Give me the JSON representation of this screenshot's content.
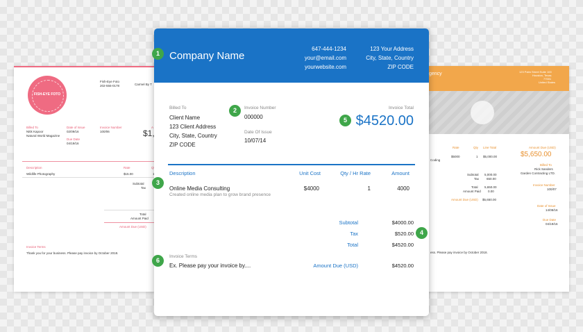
{
  "left_invoice": {
    "accent": "#ef6b82",
    "badge_text": "FISH-EYE FOTO",
    "from": [
      "Fish-Eye Foto",
      "202-555-0178"
    ],
    "from_right": "Carmel By T",
    "billed_to_label": "Billed To",
    "billed_to": [
      "Nitik Kapoor",
      "Natural World Magazine"
    ],
    "date_label": "Date of Issue",
    "date": "02/09/16",
    "invoice_no_label": "Invoice Number",
    "invoice_no": "100/06",
    "due_label": "Due Date",
    "due": "04/19/16",
    "amount_partial": "$1,",
    "a_partial": "A",
    "desc_header": "Description",
    "rate_header": "Rate",
    "qty_partial": "Qt",
    "item": "Wildlife Photography",
    "item_rate": "$15.00",
    "item_qty": "1",
    "subtotal_label": "Subtotal",
    "tax_label": "Tax",
    "total_label": "Total",
    "paid_label": "Amount Paid",
    "due_amount_label": "Amount Due (USD)",
    "terms_label": "Invoice Terms",
    "terms_text": "Thank you for your business. Please pay invoice by October 2018."
  },
  "right_invoice": {
    "accent": "#f2a74b",
    "header_title_partial": "gency",
    "address": [
      "123 Palm Street Suite 100",
      "Houston, Texas",
      "77001",
      "United States"
    ],
    "rate_header": "Rate",
    "qty_header": "Qty",
    "line_total_header": "Line Total",
    "amount_due_label": "Amount Due (USD)",
    "amount_due": "$5,650.00",
    "item_partial": "Coding",
    "item_rate": "$5000",
    "item_qty": "1",
    "item_total": "$5,000.00",
    "subtotal_label": "Subtotal",
    "subtotal": "5,000.00",
    "tax_label": "Tax",
    "tax": "650.00",
    "total_label": "Total",
    "total": "5,650.00",
    "paid_label": "Amount Paid",
    "paid": "0.00",
    "due_row_label": "Amount Due (USD)",
    "due_row": "$5,650.00",
    "billed_to_label": "Billed To",
    "billed_to": [
      "Rick Sanders",
      "Garden Contracting LTD."
    ],
    "invoice_no_label": "Invoice Number",
    "invoice_no": "100/07",
    "date_label": "Date of Issue",
    "date": "14/08/16",
    "due_label": "Due Date",
    "due": "04/19/16",
    "terms_text": "ess. Please pay invoice by October 2018."
  },
  "main_invoice": {
    "accent": "#1a73c6",
    "company_name": "Company Name",
    "contact": [
      "647-444-1234",
      "your@email.com",
      "yourwebsite.com"
    ],
    "address": [
      "123 Your Address",
      "City, State, Country",
      "ZIP CODE"
    ],
    "billed_to_label": "Billed To",
    "billed_to": [
      "Client Name",
      "123 Client Address",
      "City, State, Country",
      "ZIP CODE"
    ],
    "invoice_number_label": "Invoice Number",
    "invoice_number": "000000",
    "date_of_issue_label": "Date Of Issue",
    "date_of_issue": "10/07/14",
    "invoice_total_label": "Invoice Total",
    "invoice_total": "$4520.00",
    "columns": [
      "Description",
      "Unit Cost",
      "Qty / Hr Rate",
      "Amount"
    ],
    "line_item": {
      "title": "Online Media Consulting",
      "subtitle": "Created online media plan to grow brand presence",
      "unit_cost": "$4000",
      "qty": "1",
      "amount": "4000"
    },
    "subtotal_label": "Subtotal",
    "subtotal": "$4000.00",
    "tax_label": "Tax",
    "tax": "$520.00",
    "total_label": "Total",
    "total": "$4520.00",
    "terms_label": "Invoice Terms",
    "terms_text": "Ex. Please pay your invoice by....",
    "amount_due_label": "Amount Due (USD)",
    "amount_due": "$4520.00"
  },
  "callouts": [
    "1",
    "2",
    "3",
    "4",
    "5",
    "6"
  ]
}
